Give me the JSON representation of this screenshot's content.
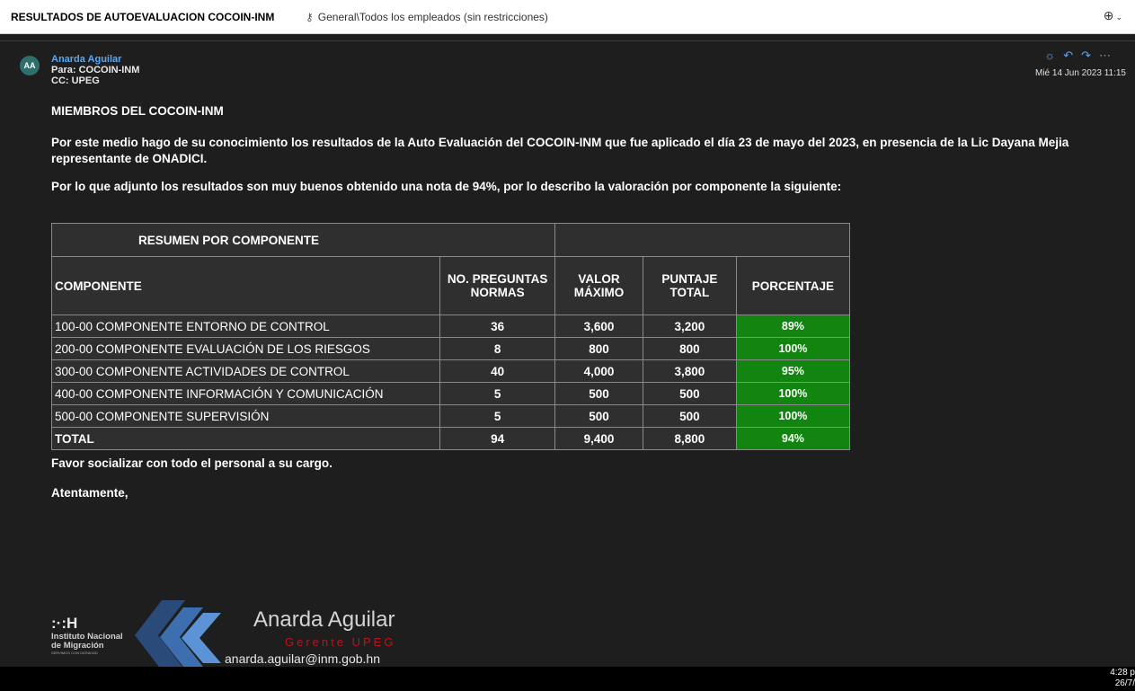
{
  "header": {
    "subject": "RESULTADOS DE AUTOEVALUACION COCOIN-INM",
    "tag": "General\\Todos los empleados (sin restricciones)"
  },
  "sender": {
    "initials": "AA",
    "name": "Anarda Aguilar",
    "to": "Para: COCOIN-INM",
    "cc": "CC: UPEG",
    "date": "Mié 14 Jun 2023 11:15"
  },
  "body": {
    "greeting": "MIEMBROS DEL COCOIN-INM",
    "paragraph1": "Por este medio hago de su conocimiento los resultados de la Auto Evaluación del COCOIN-INM que fue aplicado el día 23 de mayo del 2023, en presencia de la Lic Dayana Mejia representante de ONADICI.",
    "paragraph2": "Por lo que adjunto los resultados son muy buenos   obtenido una nota de 94%, por lo describo la valoración por componente la siguiente:",
    "closing1": "Favor socializar con todo el personal a su cargo.",
    "closing2": "Atentamente,"
  },
  "table": {
    "title": "RESUMEN POR COMPONENTE",
    "headers": {
      "componente": "COMPONENTE",
      "preguntas": "NO. PREGUNTAS NORMAS",
      "valor": "VALOR MÁXIMO",
      "puntaje": "PUNTAJE TOTAL",
      "porcentaje": "PORCENTAJE"
    },
    "rows": [
      {
        "componente": "100-00  COMPONENTE ENTORNO DE CONTROL",
        "preguntas": "36",
        "valor": "3,600",
        "puntaje": "3,200",
        "porcentaje": "89%"
      },
      {
        "componente": "200-00 COMPONENTE EVALUACIÓN DE LOS RIESGOS",
        "preguntas": "8",
        "valor": "800",
        "puntaje": "800",
        "porcentaje": "100%"
      },
      {
        "componente": "300-00 COMPONENTE ACTIVIDADES DE CONTROL",
        "preguntas": "40",
        "valor": "4,000",
        "puntaje": "3,800",
        "porcentaje": "95%"
      },
      {
        "componente": "400-00 COMPONENTE INFORMACIÓN Y COMUNICACIÓN",
        "preguntas": "5",
        "valor": "500",
        "puntaje": "500",
        "porcentaje": "100%"
      },
      {
        "componente": "500-00 COMPONENTE SUPERVISIÓN",
        "preguntas": "5",
        "valor": "500",
        "puntaje": "500",
        "porcentaje": "100%"
      }
    ],
    "total": {
      "componente": "TOTAL",
      "preguntas": "94",
      "valor": "9,400",
      "puntaje": "8,800",
      "porcentaje": "94%"
    },
    "percent_color": "#118510"
  },
  "signature": {
    "org_line1": "Instituto Nacional",
    "org_line2": "de Migración",
    "org_motto": "SERVIMOS CON DIGNIDAD",
    "name": "Anarda Aguilar",
    "role": "Gerente UPEG",
    "email": "anarda.aguilar@inm.gob.hn"
  },
  "taskbar": {
    "time": "4:28 p",
    "date": "26/7/"
  },
  "icons": {
    "tag": "tag-icon",
    "zoom": "zoom-in-icon",
    "actions": [
      "brightness-icon",
      "reply-icon",
      "forward-icon",
      "more-icon"
    ]
  }
}
